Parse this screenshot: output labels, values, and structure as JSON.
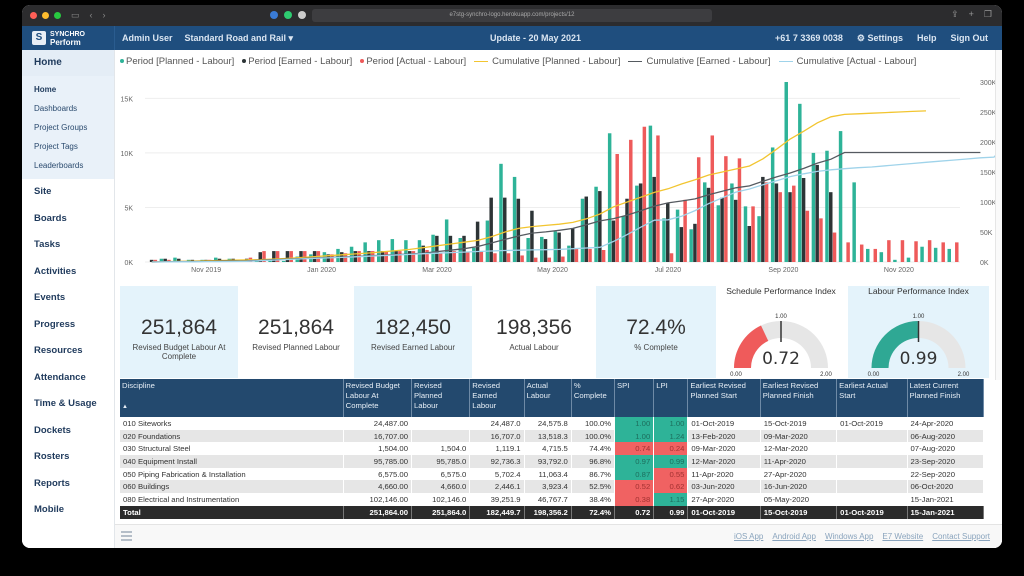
{
  "browser": {
    "url": "e7stg-synchro-logo.herokuapp.com/projects/12",
    "traffic_colors": [
      "#ff5f57",
      "#febc2e",
      "#28c840"
    ]
  },
  "appbar": {
    "logo_line1": "SYNCHRO",
    "logo_line2": "Perform",
    "user": "Admin User",
    "project": "Standard Road and Rail ▾",
    "update": "Update - 20 May 2021",
    "phone": "+61 7 3369 0038",
    "settings": "Settings",
    "help": "Help",
    "signout": "Sign Out"
  },
  "sidebar": {
    "header": "Home",
    "sub_items": [
      "Home",
      "Dashboards",
      "Project Groups",
      "Project Tags",
      "Leaderboards"
    ],
    "items": [
      "Site",
      "Boards",
      "Tasks",
      "Activities",
      "Events",
      "Progress",
      "Resources",
      "Attendance",
      "Time & Usage",
      "Dockets",
      "Rosters",
      "Reports",
      "Mobile"
    ]
  },
  "chart_data": {
    "type": "bar",
    "title": "",
    "legend": [
      {
        "name": "Period [Planned - Labour]",
        "kind": "bar",
        "color": "#2eb398"
      },
      {
        "name": "Period [Earned - Labour]",
        "kind": "bar",
        "color": "#2d3436"
      },
      {
        "name": "Period [Actual - Labour]",
        "kind": "bar",
        "color": "#ee5a5a"
      },
      {
        "name": "Cumulative [Planned - Labour]",
        "kind": "line",
        "color": "#f2c530"
      },
      {
        "name": "Cumulative [Earned - Labour]",
        "kind": "line",
        "color": "#555a60"
      },
      {
        "name": "Cumulative [Actual - Labour]",
        "kind": "line",
        "color": "#9fd3ea"
      }
    ],
    "legend_position": "top-left",
    "x_tick_labels": [
      "Nov 2019",
      "Jan 2020",
      "Mar 2020",
      "May 2020",
      "Jul 2020",
      "Sep 2020",
      "Nov 2020"
    ],
    "x_tick_positions": [
      4,
      12.5,
      21,
      29.5,
      38,
      46.5,
      55
    ],
    "y_left": {
      "ticks": [
        "0K",
        "5K",
        "10K",
        "15K"
      ],
      "range": [
        0,
        16500
      ]
    },
    "y_right": {
      "ticks": [
        "0K",
        "50K",
        "100K",
        "150K",
        "200K",
        "250K",
        "300K"
      ],
      "range": [
        0,
        300000
      ]
    },
    "periods": 60,
    "series": [
      {
        "name": "Period [Planned - Labour]",
        "axis": "left",
        "values": [
          0,
          300,
          400,
          200,
          200,
          400,
          300,
          200,
          100,
          100,
          100,
          500,
          700,
          900,
          1200,
          1400,
          1800,
          2000,
          2100,
          2000,
          2000,
          2500,
          3900,
          2200,
          1300,
          3800,
          9000,
          7800,
          2200,
          2300,
          2800,
          1500,
          5800,
          6900,
          11800,
          4200,
          7000,
          12500,
          4000,
          4800,
          3000,
          7300,
          5200,
          7200,
          5100,
          4200,
          10500,
          16500,
          14500,
          10000,
          10200,
          12000,
          7300,
          1200,
          900,
          200,
          400,
          1400,
          1300,
          1200,
          1700,
          900,
          200
        ]
      },
      {
        "name": "Period [Earned - Labour]",
        "axis": "left",
        "values": [
          200,
          300,
          300,
          200,
          200,
          300,
          300,
          300,
          900,
          1000,
          1000,
          1000,
          1000,
          700,
          900,
          1000,
          1000,
          1000,
          1000,
          1000,
          1500,
          2400,
          2400,
          2400,
          3700,
          5900,
          5900,
          5800,
          4700,
          2100,
          2700,
          3100,
          6000,
          6500,
          3800,
          5800,
          7200,
          7800,
          5400,
          3200,
          3500,
          6800,
          5900,
          5700,
          3300,
          7800,
          7200,
          6400,
          7700,
          8900,
          6400,
          0,
          0,
          0,
          0,
          0,
          0,
          0,
          0,
          0,
          0,
          0,
          0
        ]
      },
      {
        "name": "Period [Actual - Labour]",
        "axis": "left",
        "values": [
          200,
          200,
          100,
          100,
          200,
          100,
          100,
          400,
          1000,
          1000,
          1000,
          1000,
          1000,
          700,
          800,
          1000,
          1000,
          1000,
          1000,
          1000,
          1100,
          800,
          1000,
          900,
          1000,
          800,
          800,
          600,
          400,
          400,
          500,
          1200,
          1200,
          1100,
          9900,
          11200,
          12400,
          11600,
          800,
          5700,
          9600,
          11600,
          9700,
          9500,
          5100,
          7300,
          6400,
          7000,
          4700,
          4000,
          2700,
          1800,
          1600,
          1200,
          2000,
          2000,
          1900,
          2000,
          1800,
          1800,
          1900,
          1900,
          1300,
          1000
        ]
      },
      {
        "name": "Cumulative [Planned - Labour]",
        "axis": "right",
        "values": [
          0,
          500,
          1000,
          1500,
          2000,
          2500,
          3000,
          3500,
          4000,
          5000,
          6000,
          7500,
          9000,
          10500,
          12000,
          13500,
          15000,
          17000,
          19000,
          21000,
          24000,
          27000,
          30000,
          33000,
          36000,
          42000,
          50000,
          56000,
          59000,
          61000,
          63000,
          66000,
          72000,
          80000,
          92000,
          100000,
          108000,
          116000,
          122000,
          130000,
          137000,
          145000,
          150000,
          155000,
          160000,
          172000,
          188000,
          205000,
          218000,
          232000,
          242000,
          246000,
          247000,
          248000,
          249000,
          250000,
          251000,
          251864
        ]
      },
      {
        "name": "Cumulative [Earned - Labour]",
        "axis": "right",
        "values": [
          0,
          300,
          600,
          800,
          1000,
          1300,
          1600,
          1900,
          2800,
          3800,
          4800,
          5800,
          6800,
          7500,
          8400,
          9400,
          10400,
          11400,
          12400,
          13400,
          14900,
          17300,
          19700,
          22100,
          25800,
          31700,
          37600,
          43400,
          48100,
          50200,
          52900,
          56000,
          62000,
          68500,
          72300,
          78100,
          85300,
          93100,
          98500,
          101700,
          105200,
          112000,
          117900,
          123600,
          126900,
          134700,
          141900,
          148300,
          156000,
          164900,
          171300,
          182450,
          182450,
          182450,
          182450,
          182450,
          182450,
          182450,
          182450,
          182450,
          182450,
          182450
        ]
      },
      {
        "name": "Cumulative [Actual - Labour]",
        "axis": "right",
        "values": [
          0,
          200,
          300,
          400,
          600,
          700,
          800,
          1200,
          2200,
          3200,
          4200,
          5200,
          6200,
          6900,
          7700,
          8700,
          9700,
          10700,
          11700,
          12700,
          13800,
          14600,
          15600,
          16500,
          17500,
          18300,
          19100,
          19700,
          20100,
          20500,
          21000,
          22200,
          23400,
          24500,
          34400,
          45600,
          58000,
          69600,
          70400,
          76100,
          85700,
          97300,
          107000,
          116500,
          121600,
          128900,
          135300,
          142300,
          147000,
          151000,
          153700,
          155500,
          157100,
          158300,
          160300,
          162300,
          164200,
          166200,
          168000,
          169800,
          171700,
          173600,
          174900,
          198356
        ]
      }
    ]
  },
  "kpis": [
    {
      "value": "251,864",
      "label": "Revised Budget Labour At Complete"
    },
    {
      "value": "251,864",
      "label": "Revised Planned Labour"
    },
    {
      "value": "182,450",
      "label": "Revised Earned Labour"
    },
    {
      "value": "198,356",
      "label": "Actual Labour"
    },
    {
      "value": "72.4%",
      "label": "% Complete"
    }
  ],
  "gauges": [
    {
      "title": "Schedule Performance Index",
      "value": "0.72",
      "fraction": 0.36,
      "min": "0.00",
      "mid": "1.00",
      "max": "2.00",
      "color": "#ef5b5b"
    },
    {
      "title": "Labour Performance Index",
      "value": "0.99",
      "fraction": 0.495,
      "min": "0.00",
      "mid": "1.00",
      "max": "2.00",
      "color": "#2fa894"
    }
  ],
  "table": {
    "columns": [
      "Discipline",
      "Revised Budget Labour At Complete",
      "Revised Planned Labour",
      "Revised Earned Labour",
      "Actual Labour",
      "% Complete",
      "SPI",
      "LPI",
      "Earliest Revised Planned Start",
      "Earliest Revised Planned Finish",
      "Earliest Actual Start",
      "Latest Current Planned Finish"
    ],
    "sort_indicator": "▲",
    "rows": [
      [
        "010 Siteworks",
        "24,487.00",
        "",
        "24,487.0",
        "24,575.8",
        "100.0%",
        "1.00",
        "1.00",
        "01-Oct-2019",
        "15-Oct-2019",
        "01-Oct-2019",
        "24-Apr-2020"
      ],
      [
        "020 Foundations",
        "16,707.00",
        "",
        "16,707.0",
        "13,518.3",
        "100.0%",
        "1.00",
        "1.24",
        "13-Feb-2020",
        "09-Mar-2020",
        "",
        "06-Aug-2020"
      ],
      [
        "030 Structural Steel",
        "1,504.00",
        "1,504.0",
        "1,119.1",
        "4,715.5",
        "74.4%",
        "0.74",
        "0.24",
        "09-Mar-2020",
        "12-Mar-2020",
        "",
        "07-Aug-2020"
      ],
      [
        "040 Equipment Install",
        "95,785.00",
        "95,785.0",
        "92,736.3",
        "93,792.0",
        "96.8%",
        "0.97",
        "0.99",
        "12-Mar-2020",
        "11-Apr-2020",
        "",
        "23-Sep-2020"
      ],
      [
        "050 Piping Fabrication & Installation",
        "6,575.00",
        "6,575.0",
        "5,702.4",
        "11,063.4",
        "86.7%",
        "0.87",
        "0.55",
        "11-Apr-2020",
        "27-Apr-2020",
        "",
        "22-Sep-2020"
      ],
      [
        "060 Buildings",
        "4,660.00",
        "4,660.0",
        "2,446.1",
        "3,923.4",
        "52.5%",
        "0.52",
        "0.62",
        "03-Jun-2020",
        "16-Jun-2020",
        "",
        "06-Oct-2020"
      ],
      [
        "080 Electrical and Instrumentation",
        "102,146.00",
        "102,146.0",
        "39,251.9",
        "46,767.7",
        "38.4%",
        "0.38",
        "1.15",
        "27-Apr-2020",
        "05-May-2020",
        "",
        "15-Jan-2021"
      ]
    ],
    "cell_status": [
      [
        "green",
        "green"
      ],
      [
        "green",
        "green"
      ],
      [
        "red",
        "red"
      ],
      [
        "green",
        "green"
      ],
      [
        "green",
        "red"
      ],
      [
        "red",
        "red"
      ],
      [
        "red",
        "green"
      ]
    ],
    "total": [
      "Total",
      "251,864.00",
      "251,864.0",
      "182,449.7",
      "198,356.2",
      "72.4%",
      "0.72",
      "0.99",
      "01-Oct-2019",
      "15-Oct-2019",
      "01-Oct-2019",
      "15-Jan-2021"
    ]
  },
  "footer": {
    "links": [
      "iOS App",
      "Android App",
      "Windows App",
      "E7 Website",
      "Contact Support"
    ]
  }
}
